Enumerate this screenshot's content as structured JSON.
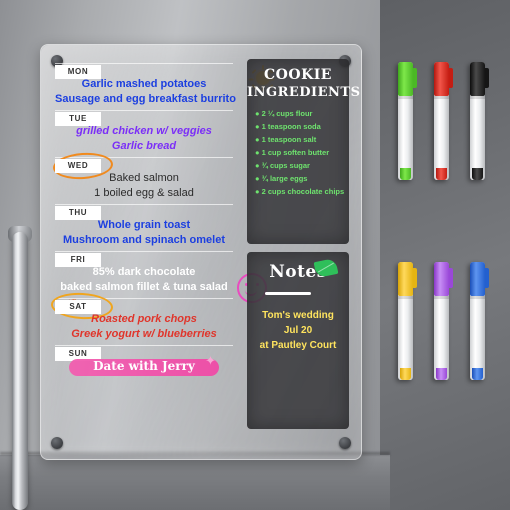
{
  "product": {
    "type": "acrylic-magnetic-fridge-planner",
    "background": "stainless-steel-refrigerator-door"
  },
  "planner": {
    "days": [
      {
        "label": "MON",
        "entries": [
          {
            "text": "Garlic mashed potatoes",
            "color": "#1c3fe0",
            "style": "bold"
          },
          {
            "text": "Sausage and egg breakfast burrito",
            "color": "#1c3fe0",
            "style": "bold"
          }
        ]
      },
      {
        "label": "TUE",
        "entries": [
          {
            "text": "grilled chicken w/ veggies",
            "color": "#7b2ff7",
            "style": "italic"
          },
          {
            "text": "Garlic bread",
            "color": "#7b2ff7",
            "style": "italic"
          }
        ]
      },
      {
        "label": "WED",
        "entries": [
          {
            "text": "Baked salmon",
            "color": "#2b2b2b",
            "style": "plain"
          },
          {
            "text": "1 boiled egg & salad",
            "color": "#2b2b2b",
            "style": "plain"
          }
        ],
        "doodle": "orange-oval-around-day-tab"
      },
      {
        "label": "THU",
        "entries": [
          {
            "text": "Whole grain toast",
            "color": "#1c3fe0",
            "style": "bold"
          },
          {
            "text": "Mushroom and spinach omelet",
            "color": "#1c3fe0",
            "style": "bold"
          }
        ],
        "doodle": "pink-smiley-face"
      },
      {
        "label": "FRI",
        "entries": [
          {
            "text": "85% dark chocolate",
            "color": "#ffffff",
            "style": "bold"
          },
          {
            "text": "baked salmon fillet & tuna salad",
            "color": "#ffffff",
            "style": "bold"
          }
        ]
      },
      {
        "label": "SAT",
        "entries": [
          {
            "text": "Roasted pork chops",
            "color": "#e0352b",
            "style": "italic"
          },
          {
            "text": "Greek yogurt w/ blueberries",
            "color": "#e0352b",
            "style": "italic"
          }
        ],
        "doodle": "orange-oval-with-scribble"
      },
      {
        "label": "SUN",
        "entries": [
          {
            "text": "Date with Jerry",
            "color": "#ffffff",
            "style": "highlighted-pink"
          }
        ],
        "doodle": "pink-highlighter-bar-and-star"
      }
    ],
    "sun_doodle": "sun-icon"
  },
  "cookie_panel": {
    "title_line1": "COOKIE",
    "title_line2": "INGREDIENTS",
    "bullet": "●",
    "ingredients": [
      "2 ¼ cups flour",
      "1 teaspoon soda",
      "1 teaspoon salt",
      "1 cup soften butter",
      "¾ cups sugar",
      "¾ large eggs",
      "2 cups chocolate chips"
    ],
    "text_color": "#6ee36e"
  },
  "notes_panel": {
    "title": "Notes",
    "lines": [
      "Tom's wedding",
      "Jul 20",
      "at Pautley Court"
    ],
    "text_color": "#ffe45e",
    "icon": "green-leaf-icon"
  },
  "markers": {
    "top_row": [
      {
        "color": "#5bd22a",
        "name": "green-marker"
      },
      {
        "color": "#e02a1e",
        "name": "red-marker"
      },
      {
        "color": "#1c1c1c",
        "name": "black-marker"
      }
    ],
    "bottom_row": [
      {
        "color": "#f0c41e",
        "name": "yellow-marker"
      },
      {
        "color": "#a855e8",
        "name": "purple-marker"
      },
      {
        "color": "#2a6ae0",
        "name": "blue-marker"
      }
    ]
  }
}
